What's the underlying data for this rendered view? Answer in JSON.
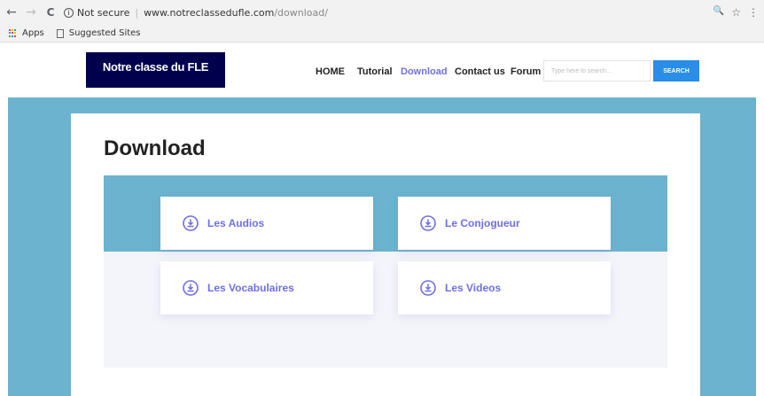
{
  "colors": {
    "accent": "#6f6ee8",
    "navy": "#00004d",
    "teal": "#6bb3cf",
    "search_blue": "#2a8de8",
    "pale": "#f4f5fb"
  },
  "browser": {
    "back_icon": "←",
    "forward_icon": "→",
    "reload_icon": "C",
    "info_icon": "i",
    "security": "Not secure",
    "url_domain": "www.notreclassedufle.com",
    "url_path": "/download/",
    "zoom_icon": "🔍",
    "star_icon": "☆",
    "menu_icon": "⋮"
  },
  "bookmarks": {
    "apps": "Apps",
    "suggested": "Suggested Sites"
  },
  "site": {
    "logo": "Notre classe du FLE",
    "nav": [
      "HOME",
      "Tutorial",
      "Download",
      "Contact us",
      "Forum"
    ],
    "search_placeholder": "Type here to search...",
    "search_button": "SEARCH"
  },
  "page": {
    "title": "Download",
    "downloads": [
      {
        "label": "Les Audios",
        "icon": "download-icon"
      },
      {
        "label": "Le Conjogueur",
        "icon": "download-icon"
      },
      {
        "label": "Les Vocabulaires",
        "icon": "download-icon"
      },
      {
        "label": "Les Videos",
        "icon": "download-icon"
      }
    ]
  }
}
